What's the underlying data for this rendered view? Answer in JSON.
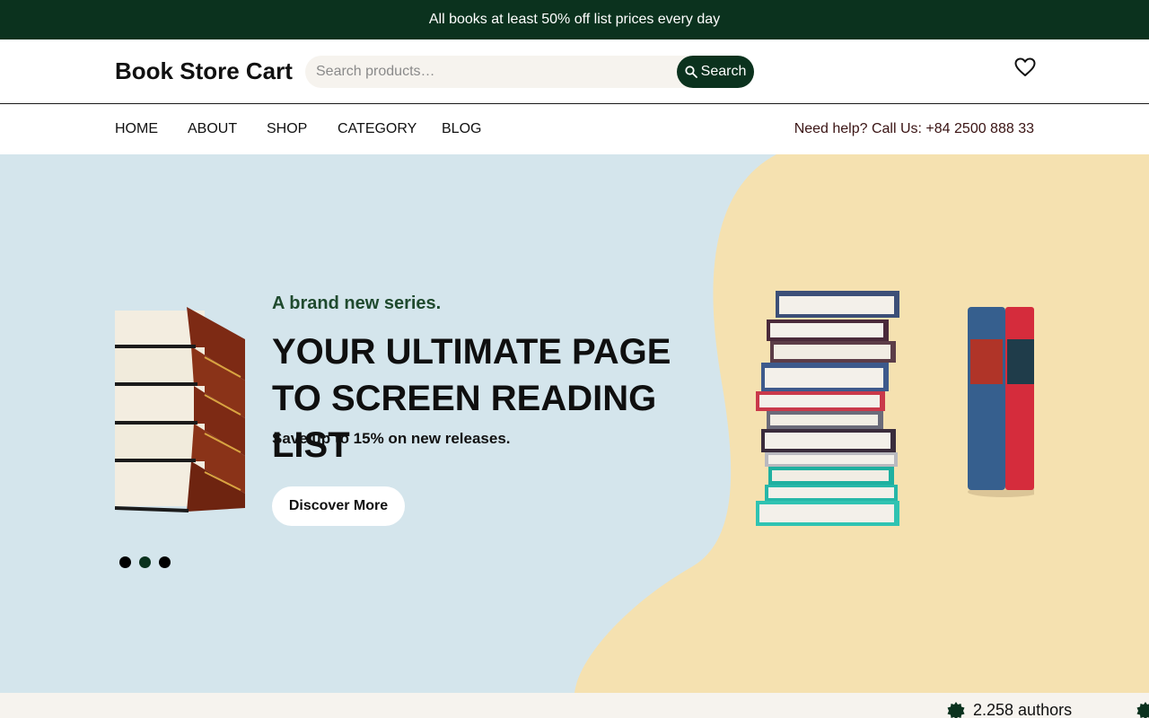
{
  "topbar": {
    "promo": "All books at least 50% off list prices every day"
  },
  "header": {
    "logo": "Book Store Cart",
    "search": {
      "placeholder": "Search products…",
      "value": "",
      "button_label": "Search"
    }
  },
  "nav": {
    "items": [
      {
        "label": "HOME"
      },
      {
        "label": "ABOUT"
      },
      {
        "label": "SHOP"
      },
      {
        "label": "CATEGORY"
      },
      {
        "label": "BLOG"
      }
    ],
    "help": "Need help? Call Us: +84 2500 888 33"
  },
  "hero": {
    "subtitle": "A brand new series.",
    "title": "YOUR ULTIMATE PAGE TO SCREEN READING LIST",
    "description": "Save up to 15% on new releases.",
    "cta": "Discover More",
    "slides_total": 3,
    "active_slide": 2
  },
  "stats": {
    "authors": "2.258 authors"
  },
  "colors": {
    "brand_dark_green": "#0b321e",
    "hero_blue": "#d4e5ec",
    "hero_sand": "#f5e1b0",
    "stats_bg": "#f6f3ee"
  },
  "icons": [
    "search-icon",
    "heart-icon",
    "badge-icon"
  ]
}
